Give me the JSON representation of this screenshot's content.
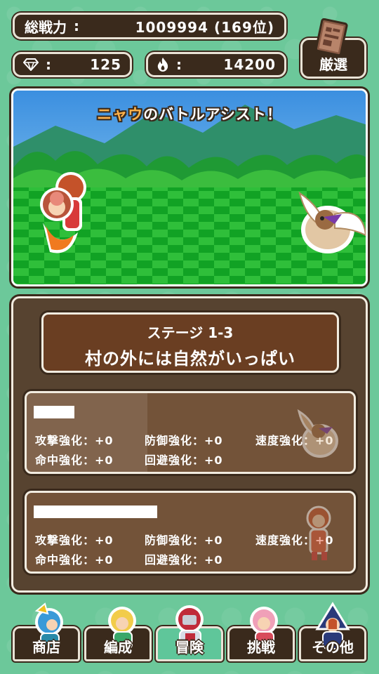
{
  "header": {
    "power_label": "総戦力",
    "colon": ":",
    "power_value": "1009994 (169位)",
    "gems_value": "125",
    "fire_value": "14200",
    "select_label": "厳選"
  },
  "icons": {
    "gem": "diamond-icon",
    "fire": "flame-icon",
    "book": "spellbook-icon"
  },
  "scene": {
    "assist_name": "ニャウ",
    "assist_rest": "のバトルアシスト！"
  },
  "stage": {
    "number": "ステージ 1-3",
    "name": "村の外には自然がいっぱい"
  },
  "cards": [
    {
      "stats": {
        "atk": "攻撃強化：+0",
        "def": "防御強化：+0",
        "spd": "速度強化：+0",
        "hit": "命中強化：+0",
        "eva": "回避強化：+0"
      }
    },
    {
      "stats": {
        "atk": "攻撃強化：+0",
        "def": "防御強化：+0",
        "spd": "速度強化：+0",
        "hit": "命中強化：+0",
        "eva": "回避強化：+0"
      }
    }
  ],
  "nav": {
    "shop": "商店",
    "formation": "編成",
    "adventure": "冒険",
    "challenge": "挑戦",
    "other": "その他"
  },
  "colors": {
    "background": "#6cc89a",
    "panel": "#574330",
    "accent_name": "#ffb24a"
  }
}
